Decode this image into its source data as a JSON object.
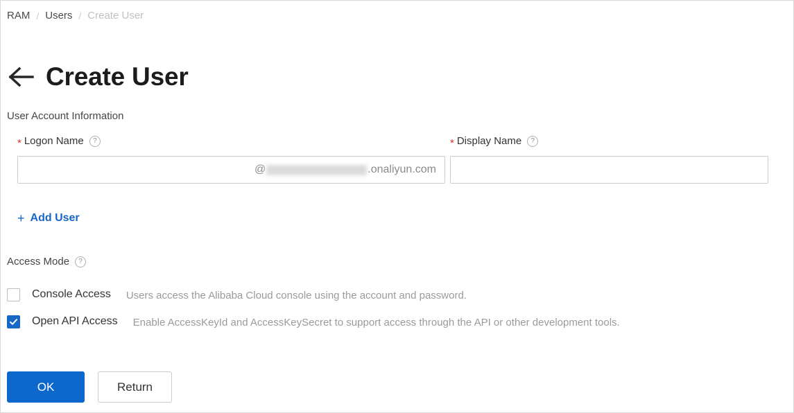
{
  "breadcrumb": {
    "items": [
      {
        "label": "RAM",
        "current": false
      },
      {
        "label": "Users",
        "current": false
      },
      {
        "label": "Create User",
        "current": true
      }
    ],
    "separator": "/"
  },
  "header": {
    "back_icon": "arrow-left-icon",
    "title": "Create User"
  },
  "account_section": {
    "heading": "User Account Information",
    "logon": {
      "label": "Logon Name",
      "required_marker": "*",
      "help_icon": "question-circle-icon",
      "value": "",
      "placeholder": "",
      "suffix_prefix": "@",
      "suffix_redacted": "",
      "suffix_domain": ".onaliyun.com"
    },
    "display": {
      "label": "Display Name",
      "required_marker": "*",
      "help_icon": "question-circle-icon",
      "value": "",
      "placeholder": ""
    },
    "add_user": {
      "icon": "plus-icon",
      "plus": "+",
      "label": "Add User"
    }
  },
  "access_mode": {
    "label": "Access Mode",
    "help_icon": "question-circle-icon",
    "options": [
      {
        "label": "Console Access",
        "description": "Users access the Alibaba Cloud console using the account and password.",
        "checked": false
      },
      {
        "label": "Open API Access",
        "description": "Enable AccessKeyId and AccessKeySecret to support access through the API or other development tools.",
        "checked": true
      }
    ]
  },
  "actions": {
    "ok_label": "OK",
    "return_label": "Return"
  },
  "colors": {
    "accent_blue": "#0d68cd",
    "link_blue": "#1766c6",
    "checkbox_blue": "#1668c8",
    "required_red": "#d93026",
    "muted_gray": "#9a9a9a",
    "border_gray": "#c4ccd4"
  }
}
